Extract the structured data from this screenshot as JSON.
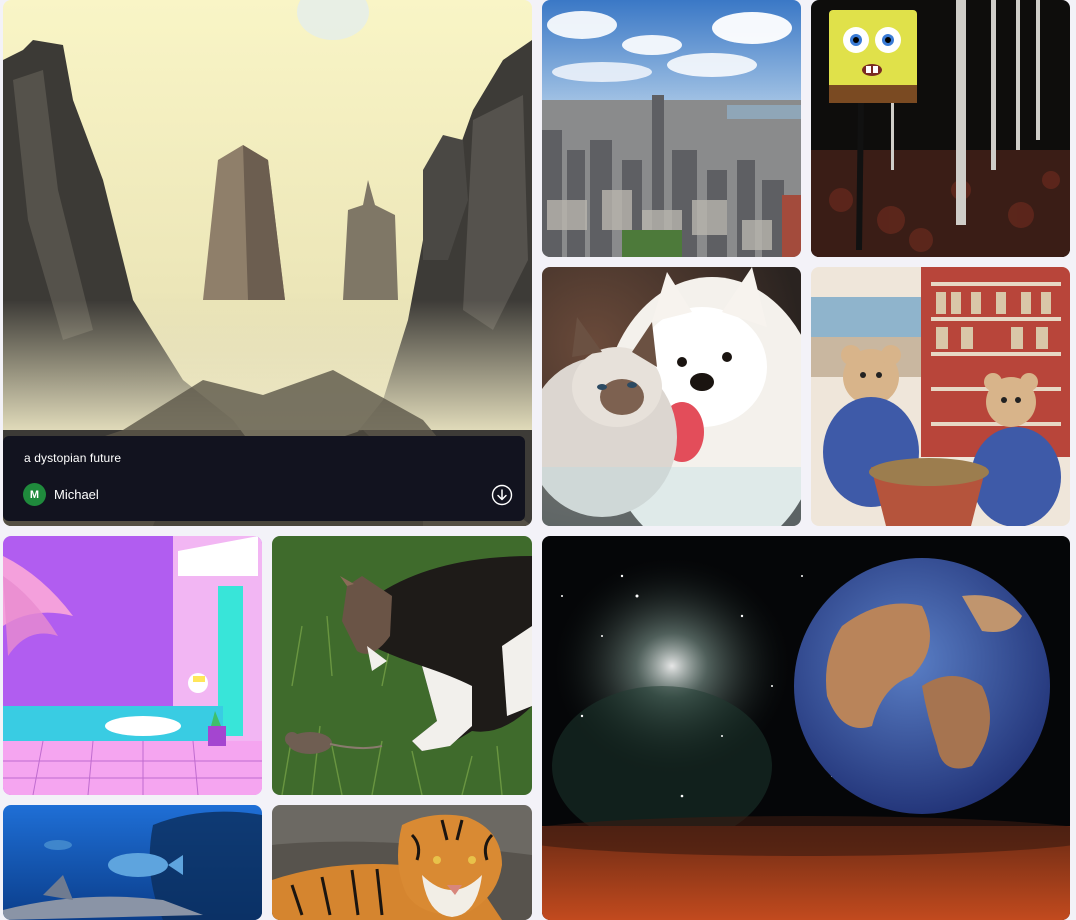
{
  "gallery": {
    "featured": {
      "prompt": "a dystopian future",
      "user": {
        "initial": "M",
        "name": "Michael"
      },
      "download_icon": "download-circle-icon"
    },
    "images": [
      "dystopian-city",
      "new-york-skyline",
      "spongebob-forest",
      "cat-and-samoyed",
      "teddy-bears-shop",
      "vaporwave-astronaut",
      "cat-and-mouse",
      "earth-from-space",
      "aquarium-shark",
      "tiger"
    ]
  }
}
